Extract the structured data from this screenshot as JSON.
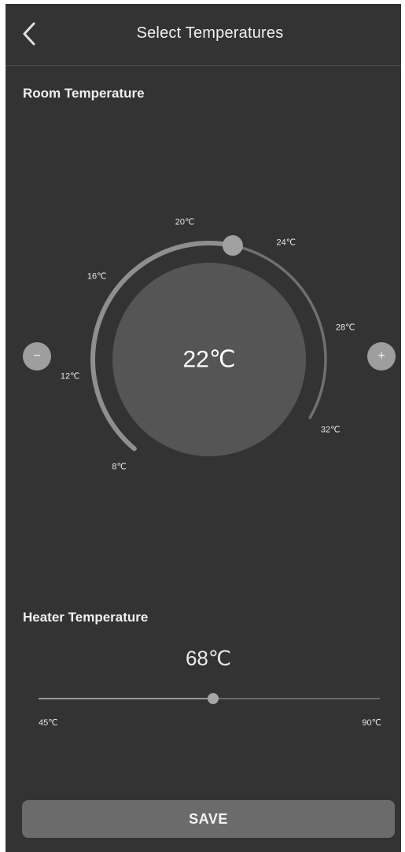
{
  "header": {
    "title": "Select Temperatures",
    "back_icon": "chevron-left-icon"
  },
  "room": {
    "title": "Room Temperature",
    "value_label": "22℃",
    "value": 22,
    "min": 8,
    "max": 32,
    "ticks": [
      "8℃",
      "12℃",
      "16℃",
      "20℃",
      "24℃",
      "28℃",
      "32℃"
    ],
    "minus_icon": "minus-icon",
    "plus_icon": "plus-icon",
    "minus_label": "−",
    "plus_label": "+"
  },
  "heater": {
    "title": "Heater Temperature",
    "value_label": "68℃",
    "value": 68,
    "min": 45,
    "max": 90,
    "min_label": "45℃",
    "max_label": "90℃"
  },
  "footer": {
    "save_label": "SAVE"
  },
  "colors": {
    "background": "#333333",
    "dial_center": "#555555",
    "arc_active": "#8f8f8f",
    "arc_inactive": "#707070",
    "button": "#6b6b6b"
  }
}
